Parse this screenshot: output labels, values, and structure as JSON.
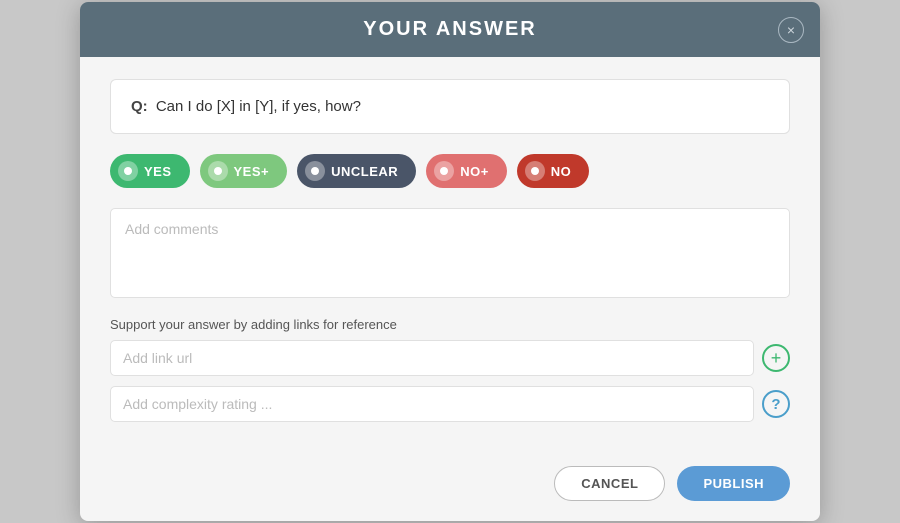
{
  "modal": {
    "title": "YOUR ANSWER",
    "close_label": "×"
  },
  "question": {
    "prefix": "Q:",
    "text": "Can I do [X] in [Y], if yes, how?"
  },
  "answer_options": [
    {
      "id": "yes",
      "label": "YES",
      "class": "btn-yes"
    },
    {
      "id": "yes-plus",
      "label": "YES+",
      "class": "btn-yes-plus"
    },
    {
      "id": "unclear",
      "label": "UNCLEAR",
      "class": "btn-unclear"
    },
    {
      "id": "no-plus",
      "label": "NO+",
      "class": "btn-no-plus"
    },
    {
      "id": "no",
      "label": "NO",
      "class": "btn-no"
    }
  ],
  "comments": {
    "placeholder": "Add comments"
  },
  "support_label": "Support your answer by adding links for reference",
  "link_input": {
    "placeholder": "Add link url"
  },
  "complexity_input": {
    "placeholder": "Add complexity rating ..."
  },
  "add_icon": "+",
  "help_icon": "?",
  "footer": {
    "cancel_label": "CANCEL",
    "publish_label": "PUBLISH"
  }
}
